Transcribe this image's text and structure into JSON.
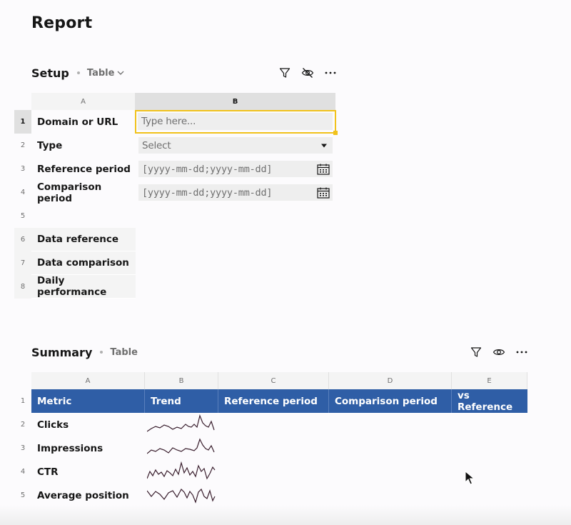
{
  "page": {
    "title": "Report"
  },
  "setup": {
    "title": "Setup",
    "type_label": "Table",
    "columns": [
      "A",
      "B"
    ],
    "rows": [
      {
        "num": "1",
        "label": "Domain or URL",
        "value": "Type here...",
        "kind": "text"
      },
      {
        "num": "2",
        "label": "Type",
        "value": "Select",
        "kind": "select"
      },
      {
        "num": "3",
        "label": "Reference period",
        "value": "[yyyy-mm-dd;yyyy-mm-dd]",
        "kind": "date"
      },
      {
        "num": "4",
        "label": "Comparison period",
        "value": "[yyyy-mm-dd;yyyy-mm-dd]",
        "kind": "date"
      },
      {
        "num": "5",
        "label": "",
        "value": "",
        "kind": "empty"
      },
      {
        "num": "6",
        "label": "Data reference",
        "kind": "section"
      },
      {
        "num": "7",
        "label": "Data comparison",
        "kind": "section"
      },
      {
        "num": "8",
        "label": "Daily performance",
        "kind": "section"
      }
    ],
    "icons": [
      "filter-icon",
      "eye-off-icon",
      "overflow-menu-icon"
    ]
  },
  "summary": {
    "title": "Summary",
    "type_label": "Table",
    "columns": [
      "A",
      "B",
      "C",
      "D",
      "E"
    ],
    "headers": [
      "Metric",
      "Trend",
      "Reference period",
      "Comparison period",
      "vs Reference"
    ],
    "header_row_num": "1",
    "rows": [
      {
        "num": "2",
        "metric": "Clicks"
      },
      {
        "num": "3",
        "metric": "Impressions"
      },
      {
        "num": "4",
        "metric": "CTR"
      },
      {
        "num": "5",
        "metric": "Average position"
      }
    ],
    "icons": [
      "filter-icon",
      "eye-icon",
      "overflow-menu-icon"
    ]
  },
  "colors": {
    "accent": "#2f5ea6",
    "focus": "#f1c21b",
    "sparkline": "#3a1f2e"
  }
}
